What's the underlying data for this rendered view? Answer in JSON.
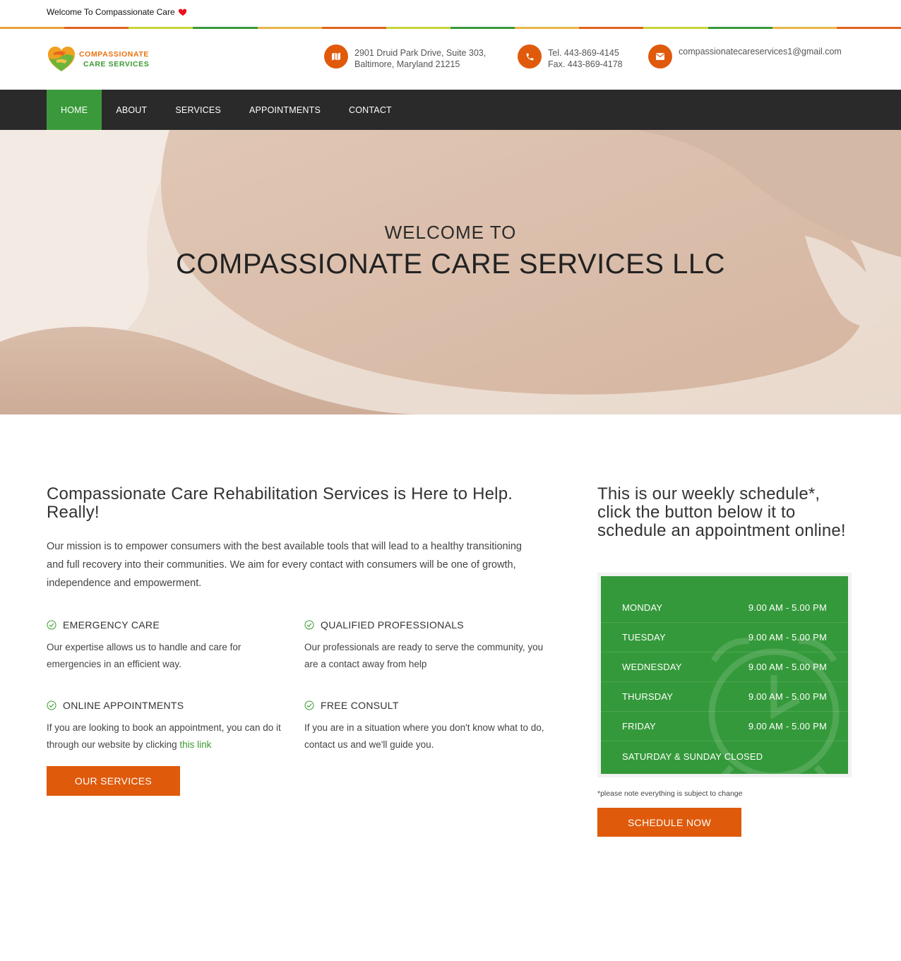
{
  "topbar": {
    "welcome": "Welcome To Compassionate Care",
    "heart_icon": "heart-icon"
  },
  "stripe_colors": [
    "#e8a23c",
    "#e0641d",
    "#c8d43a",
    "#3a9a3b",
    "#e8b64a",
    "#e0641d",
    "#c8d43a",
    "#3a9a3b",
    "#e8b64a",
    "#e0641d",
    "#c8d43a",
    "#3a9a3b",
    "#e8b64a",
    "#e0641d"
  ],
  "header": {
    "logo": {
      "line1": "COMPASSIONATE",
      "line2": "CARE SERVICES"
    },
    "address": {
      "icon": "map-icon",
      "line1": "2901 Druid Park Drive, Suite 303,",
      "line2": "Baltimore, Maryland 21215"
    },
    "phone": {
      "icon": "phone-icon",
      "line1": "Tel. 443-869-4145",
      "line2": "Fax. 443-869-4178"
    },
    "email": {
      "icon": "envelope-icon",
      "line1": "compassionatecareservices1@gmail.com"
    }
  },
  "nav": {
    "items": [
      {
        "label": "HOME",
        "active": true
      },
      {
        "label": "ABOUT",
        "active": false
      },
      {
        "label": "SERVICES",
        "active": false
      },
      {
        "label": "APPOINTMENTS",
        "active": false
      },
      {
        "label": "CONTACT",
        "active": false
      }
    ]
  },
  "hero": {
    "subtitle": "WELCOME TO",
    "title": "COMPASSIONATE CARE SERVICES LLC"
  },
  "intro": {
    "heading": "Compassionate Care Rehabilitation Services is Here to Help. Really!",
    "mission": "Our mission is to empower consumers with the best available tools that will lead to a healthy transitioning and full recovery into their communities. We aim for every contact with consumers will be one of growth, independence and empowerment.",
    "features": [
      {
        "title": "EMERGENCY CARE",
        "desc": "Our expertise allows us to handle and care for emergencies in an efficient way."
      },
      {
        "title": "QUALIFIED PROFESSIONALS",
        "desc": "Our professionals are ready to serve the community, you are a contact away from help"
      },
      {
        "title": "ONLINE APPOINTMENTS",
        "desc": "If you are looking to book an appointment, you can do it through our website by clicking ",
        "link": "this link"
      },
      {
        "title": "FREE CONSULT",
        "desc": "If you are in a situation where you don't know what to do, contact us and we'll guide you."
      }
    ],
    "button": "OUR SERVICES"
  },
  "schedule": {
    "heading": "This is our weekly schedule*, click the button below it to schedule an appointment online!",
    "rows": [
      {
        "day": "MONDAY",
        "hours": "9.00 AM - 5.00 PM"
      },
      {
        "day": "TUESDAY",
        "hours": "9.00 AM - 5.00 PM"
      },
      {
        "day": "WEDNESDAY",
        "hours": "9.00 AM - 5.00 PM"
      },
      {
        "day": "THURSDAY",
        "hours": "9.00 AM - 5.00 PM"
      },
      {
        "day": "FRIDAY",
        "hours": "9.00 AM - 5.00 PM"
      },
      {
        "day": "SATURDAY & SUNDAY CLOSED",
        "hours": ""
      }
    ],
    "note": "*please note everything is subject to change",
    "button": "SCHEDULE NOW",
    "background_icon": "alarm-clock-icon"
  },
  "colors": {
    "accent_orange": "#df5a0b",
    "accent_green": "#3a9a3b",
    "nav_bg": "#2a2a2a"
  }
}
